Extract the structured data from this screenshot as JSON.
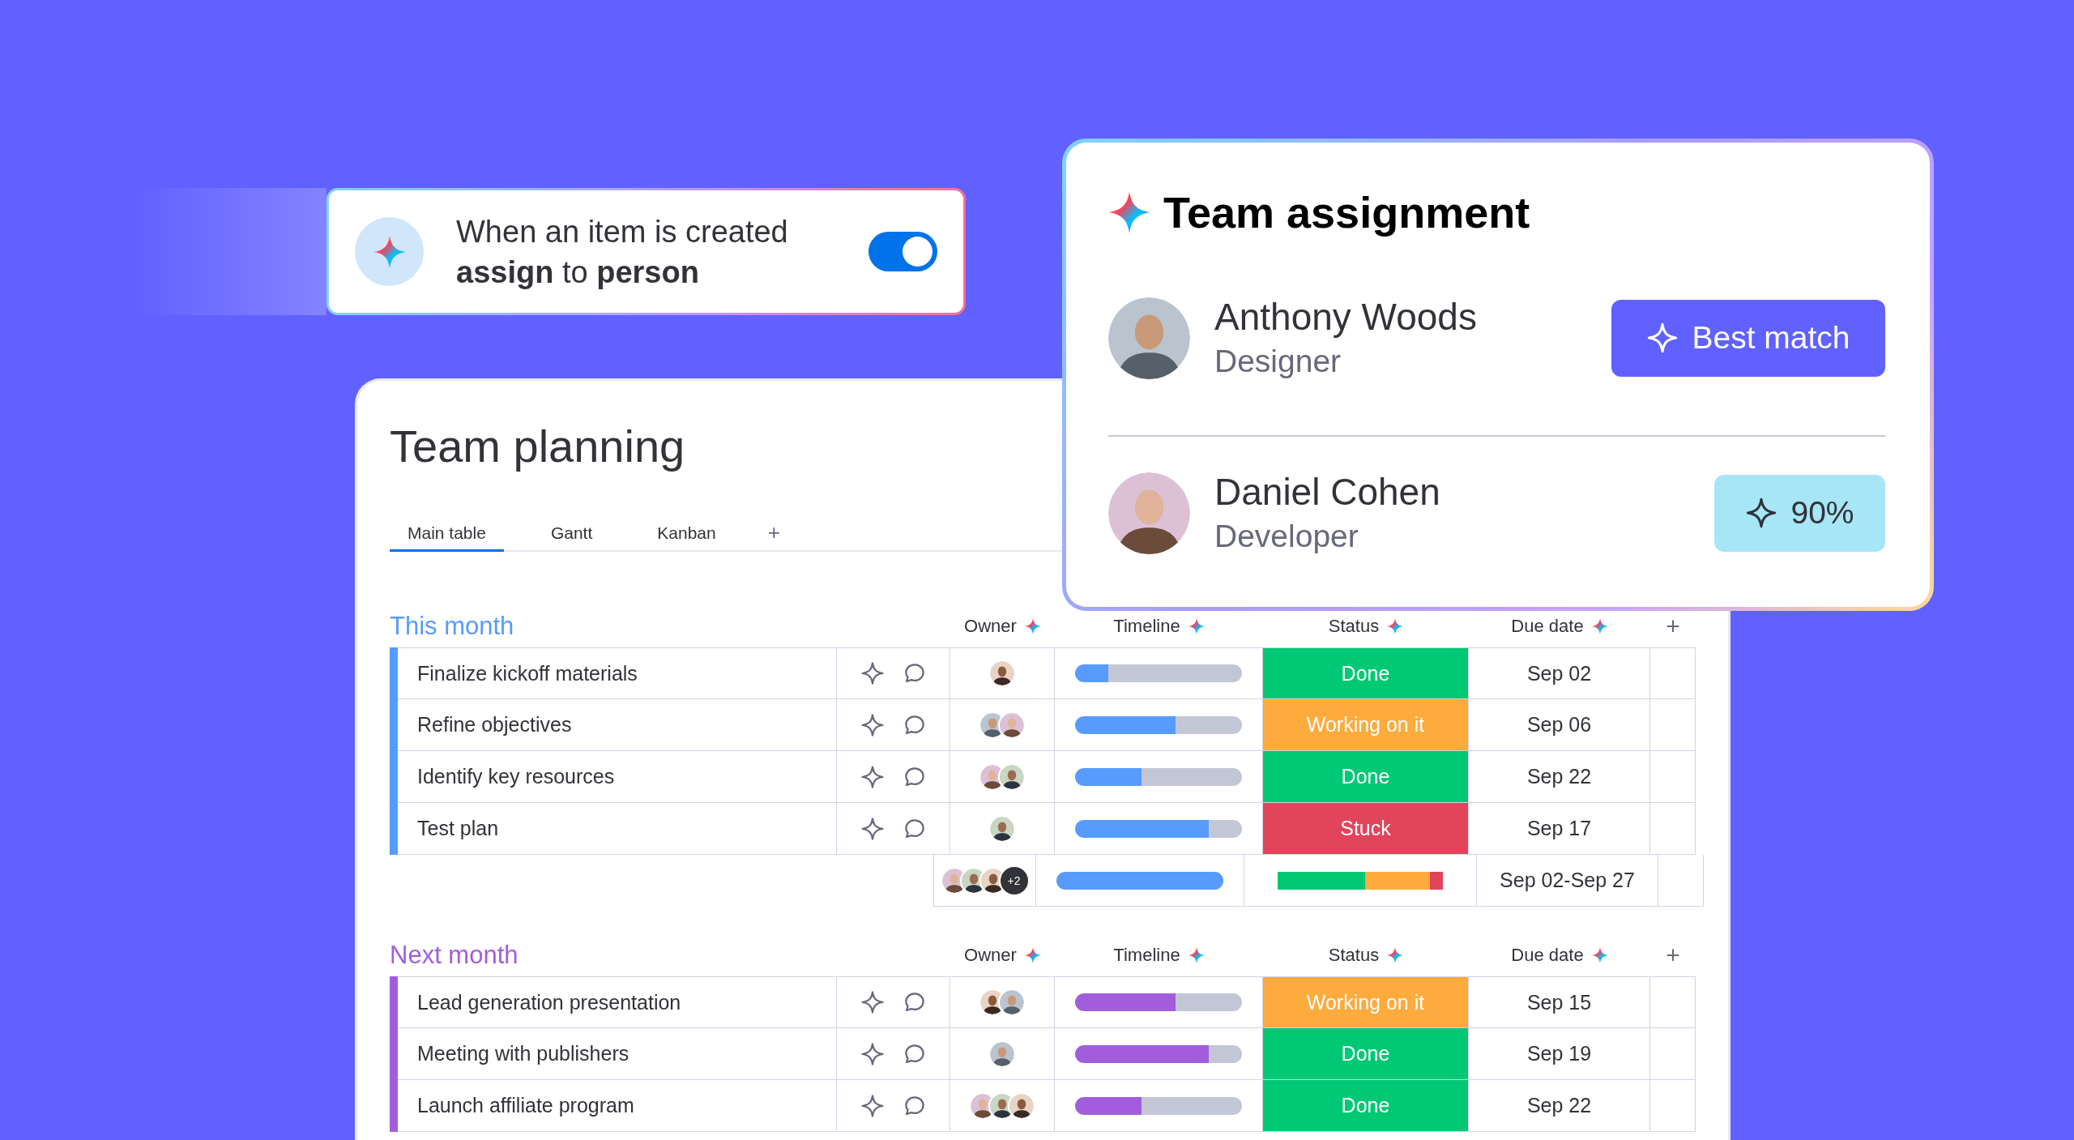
{
  "automation": {
    "line_1": "When an item is created",
    "line_2": "**assign** to **person**",
    "toggle": {
      "on": true
    }
  },
  "assignment": {
    "title": "Team assignment",
    "candidates": [
      {
        "name": "Anthony Woods",
        "role": "Designer",
        "badge": "Best match",
        "kind": "best"
      },
      {
        "name": "Daniel Cohen",
        "role": "Developer",
        "badge": "90%",
        "kind": "score"
      }
    ]
  },
  "board": {
    "title": "Team planning",
    "tabs": [
      {
        "label": "Main table",
        "selected": true
      },
      {
        "label": "Gantt",
        "selected": false
      },
      {
        "label": "Kanban",
        "selected": false
      }
    ],
    "add_tab": "+",
    "groups": [
      {
        "title": "This month",
        "color": "#579bfc",
        "columns": [
          "Owner",
          "Timeline",
          "Status",
          "Due date"
        ],
        "add_column": "+",
        "rows": [
          {
            "name": "Finalize kickoff materials",
            "timeline": {
              "level": 0.2
            },
            "status": {
              "label": "Done",
              "color": "#00c875"
            },
            "due": "Sep 02"
          },
          {
            "name": "Refine objectives",
            "timeline": {
              "level": 0.6
            },
            "status": {
              "label": "Working on it",
              "color": "#fdab3d"
            },
            "due": "Sep 06"
          },
          {
            "name": "Identify key resources",
            "timeline": {
              "level": 0.4
            },
            "status": {
              "label": "Done",
              "color": "#00c875"
            },
            "due": "Sep 22"
          },
          {
            "name": "Test plan",
            "timeline": {
              "level": 0.8
            },
            "status": {
              "label": "Stuck",
              "color": "#e2445c"
            },
            "due": "Sep 17"
          }
        ],
        "summary": {
          "more_owners": "+2",
          "timeline": {
            "level": 1
          },
          "status_segments": [
            {
              "color": "#00c875"
            },
            {
              "color": "#fdab3d"
            },
            {
              "color": "#e2445c"
            }
          ],
          "due": "Sep 02-Sep 27"
        }
      },
      {
        "title": "Next month",
        "color": "#a25ddc",
        "columns": [
          "Owner",
          "Timeline",
          "Status",
          "Due date"
        ],
        "add_column": "+",
        "rows": [
          {
            "name": "Lead generation presentation",
            "timeline": {
              "level": 0.6
            },
            "status": {
              "label": "Working on it",
              "color": "#fdab3d"
            },
            "due": "Sep 15"
          },
          {
            "name": "Meeting with publishers",
            "timeline": {
              "level": 0.8
            },
            "status": {
              "label": "Done",
              "color": "#00c875"
            },
            "due": "Sep 19"
          },
          {
            "name": "Launch affiliate program",
            "timeline": {
              "level": 0.4
            },
            "status": {
              "label": "Done",
              "color": "#00c875"
            },
            "due": "Sep 22"
          }
        ]
      }
    ]
  }
}
